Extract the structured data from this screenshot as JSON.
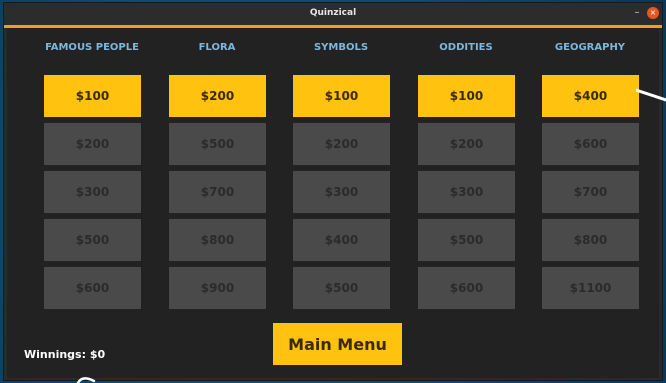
{
  "window": {
    "title": "Quinzical",
    "minimize_symbol": "–",
    "close_symbol": "×"
  },
  "board": {
    "categories": [
      {
        "name": "FAMOUS PEOPLE",
        "tiles": [
          {
            "label": "$100",
            "state": "active"
          },
          {
            "label": "$200",
            "state": "used"
          },
          {
            "label": "$300",
            "state": "used"
          },
          {
            "label": "$500",
            "state": "used"
          },
          {
            "label": "$600",
            "state": "used"
          }
        ]
      },
      {
        "name": "FLORA",
        "tiles": [
          {
            "label": "$200",
            "state": "active"
          },
          {
            "label": "$500",
            "state": "used"
          },
          {
            "label": "$700",
            "state": "used"
          },
          {
            "label": "$800",
            "state": "used"
          },
          {
            "label": "$900",
            "state": "used"
          }
        ]
      },
      {
        "name": "SYMBOLS",
        "tiles": [
          {
            "label": "$100",
            "state": "active"
          },
          {
            "label": "$200",
            "state": "used"
          },
          {
            "label": "$300",
            "state": "used"
          },
          {
            "label": "$400",
            "state": "used"
          },
          {
            "label": "$500",
            "state": "used"
          }
        ]
      },
      {
        "name": "ODDITIES",
        "tiles": [
          {
            "label": "$100",
            "state": "active"
          },
          {
            "label": "$200",
            "state": "used"
          },
          {
            "label": "$300",
            "state": "used"
          },
          {
            "label": "$500",
            "state": "used"
          },
          {
            "label": "$600",
            "state": "used"
          }
        ]
      },
      {
        "name": "GEOGRAPHY",
        "tiles": [
          {
            "label": "$400",
            "state": "active"
          },
          {
            "label": "$600",
            "state": "used"
          },
          {
            "label": "$700",
            "state": "used"
          },
          {
            "label": "$800",
            "state": "used"
          },
          {
            "label": "$1100",
            "state": "used"
          }
        ]
      }
    ]
  },
  "main_menu_label": "Main Menu",
  "winnings_label": "Winnings: $0",
  "colors": {
    "accent": "#ffc20e",
    "tile_used": "#4a4a4a",
    "category_text": "#7fb6d9",
    "titlebar_border": "#f0a01e",
    "background": "#222222"
  }
}
